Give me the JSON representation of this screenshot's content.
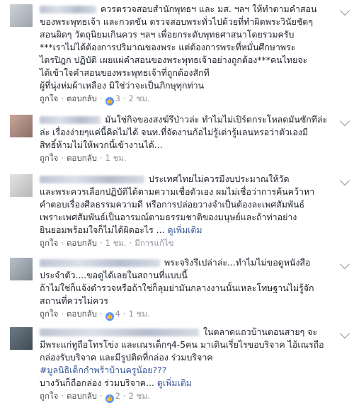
{
  "comments": [
    {
      "lines": [
        "ควรตรวจสอบสำนักพุทธฯ และ มส. ฯลฯ ให้ทำตามคำสอน",
        "ของพระพุทธเจ้า และกวดขัน ตรวจสอบพระทั่วไปด้วยที่ทำผิดพระวินัยชัดๆ",
        "สอนผิดๆ วัตถุนิยมเกินควร ฯลฯ เพื่อยกระดับพุทธศาสนาโดยรวมครับ",
        "***เราไม่ได้ต้องการปริมาณของพระ แต่ต้องการพระที่หมั่นศึกษาพระ",
        "ไตรปิฎก ปฏิบัติ เผยแผ่คำสอนของพระพุทธเจ้าอย่างถูกต้อง***คนไทยจะ",
        "ได้เข้าใจคำสอนของพระพุทธเจ้าที่ถูกต้องสักที",
        "ผู้ที่นุ่งห่มผ้าเหลือง มิใช่ว่าจะเป็นภิกษุทุกท่าน"
      ],
      "like_label": "ถูกใจ",
      "reply_label": "ตอบกลับ",
      "reactions": "3",
      "time": "2 ชม."
    },
    {
      "lines": [
        "มันใช่กิจของสงฆ์รึป่าวล่ะ ทำไมไม่เปิร์ตกระโหลดมันซักทีล่ะ",
        "ล่ะ เรื่องง่ายๆแค่นี้คิดไม่ได้ จนท.ที่จัดงานก้อไม่รู้เต่ารู้แลนหรอว่าตัวเองมี",
        "สิทธิ์ห้ามไม่ให้พวกนี้เข้างานได้..."
      ],
      "like_label": "ถูกใจ",
      "reply_label": "ตอบกลับ",
      "time": "1 ชม."
    },
    {
      "lines": [
        "ประเทศไทยไม่ควรมีงบประมาณให้วัด",
        "และพระควรเลือกปฏิบัติได้ตามความเชื่อตัวเอง ผมไม่เชื่อว่าการค้นคว้าหา",
        "คำตอบเรื่องศีลธรรมความดี หรือการปล่อยวางจำเป็นต้องละเพศสัมพันธ์",
        "เพราะเพศสัมพันธ์เป็นอารมณ์ตามธรรมชาติของมนุษย์และถ้าท่าอย่าง",
        "ยินยอมพร้อมใจก็ไม่ได้ผิดอะไร ..."
      ],
      "see_more": "ดูเพิ่มเติม",
      "like_label": "ถูกใจ",
      "reply_label": "ตอบกลับ",
      "time": "1 ชม.",
      "edited": "มีการแก้ไข"
    },
    {
      "lines": [
        "พระจริงรึเปล่าล่ะ...ทำไมไม่ขอดูหนังสือ",
        "ประจำตัว....ขอดูได้เลยในสถานที่แบบนี้",
        "ถ้าไม่ใช่ก็แจ้งตำรวจหรือถ้าใช่ก็ลุมย่ามันกลางงานนั้นเหละโทษฐานไม่รู้จัก",
        "สถานที่ควรไม่ควร"
      ],
      "like_label": "ถูกใจ",
      "reply_label": "ตอบกลับ",
      "reactions": "4",
      "time": "1 ชม."
    },
    {
      "lines": [
        "ในตลาดแถวบ้านตอนสายๆ จะ",
        "มีพระแก่ทูถือโทรโข่ง และเณรเด็กๆ4-5คน มาเดินเรี่ยไรขอบริจาค ไอ้เณรถือ",
        "กล่องรับบริจาค และมีรูปติดที่กล่อง ร่วมบริจาค",
        "#มูลนิธิเด็กกำพร้าบ้านครูน้อย???",
        "บางวันก็ถือกล่อง ร่วมบริจาค..."
      ],
      "see_more": "ดูเพิ่มเติม",
      "like_label": "ถูกใจ",
      "reply_label": "ตอบกลับ",
      "reactions": "2",
      "time": "2 ชม."
    }
  ]
}
